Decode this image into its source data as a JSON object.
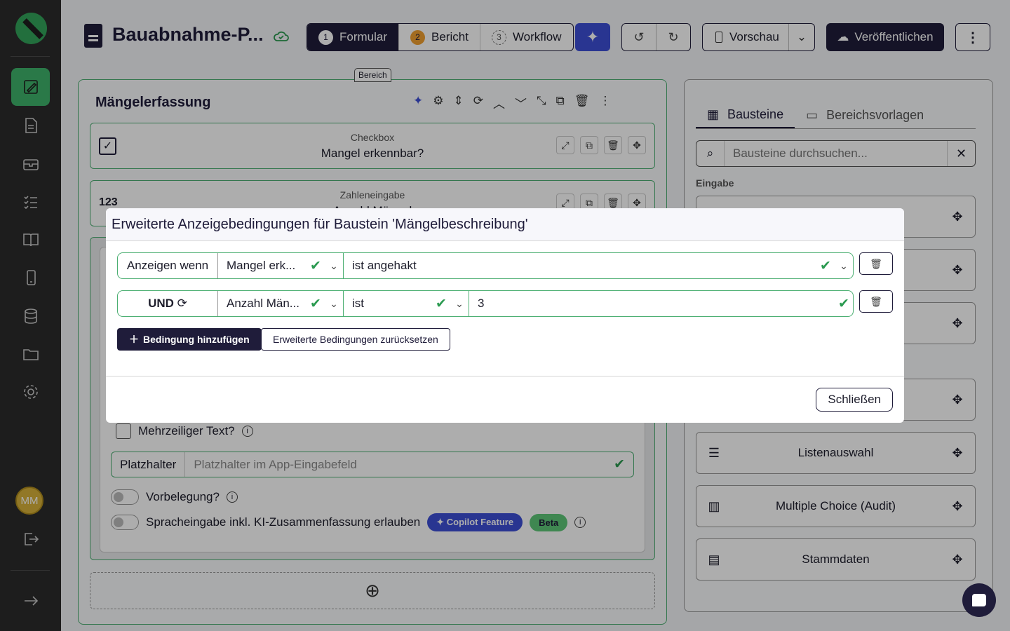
{
  "header": {
    "title": "Bauabnahme-P...",
    "steps": [
      {
        "num": "1",
        "label": "Formular"
      },
      {
        "num": "2",
        "label": "Bericht"
      },
      {
        "num": "3",
        "label": "Workflow"
      }
    ],
    "preview_label": "Vorschau",
    "publish_label": "Veröffentlichen"
  },
  "area": {
    "tag": "Bereich",
    "title": "Mängelerfassung",
    "blocks": [
      {
        "type": "Checkbox",
        "name": "Mangel erkennbar?"
      },
      {
        "type": "Zahleneingabe",
        "name": "Anzahl Mängel",
        "prefix": "123"
      }
    ],
    "multiline_label": "Mehrzeiliger Text?",
    "placeholder_addon": "Platzhalter",
    "placeholder_hint": "Platzhalter im App-Eingabefeld",
    "prefill_label": "Vorbelegung?",
    "voice_label": "Spracheingabe inkl. KI-Zusammenfassung erlauben",
    "copilot_pill": "Copilot Feature",
    "beta_pill": "Beta"
  },
  "right_panel": {
    "tabs": [
      "Bausteine",
      "Bereichsvorlagen"
    ],
    "search_placeholder": "Bausteine durchsuchen...",
    "section": "Eingabe",
    "tiles": [
      "Listenauswahl",
      "Multiple Choice (Audit)",
      "Stammdaten"
    ]
  },
  "sidebar": {
    "avatar_initials": "MM"
  },
  "modal": {
    "title": "Erweiterte Anzeigebedingungen für Baustein 'Mängelbeschreibung'",
    "conditions": [
      {
        "lead": "Anzeigen wenn",
        "field": "Mangel erk...",
        "operator": "ist angehakt",
        "value": ""
      },
      {
        "lead": "UND",
        "field": "Anzahl Män...",
        "operator": "ist",
        "value": "3"
      }
    ],
    "add_button": "Bedingung hinzufügen",
    "reset_button": "Erweiterte Bedingungen zurücksetzen",
    "close_button": "Schließen"
  }
}
